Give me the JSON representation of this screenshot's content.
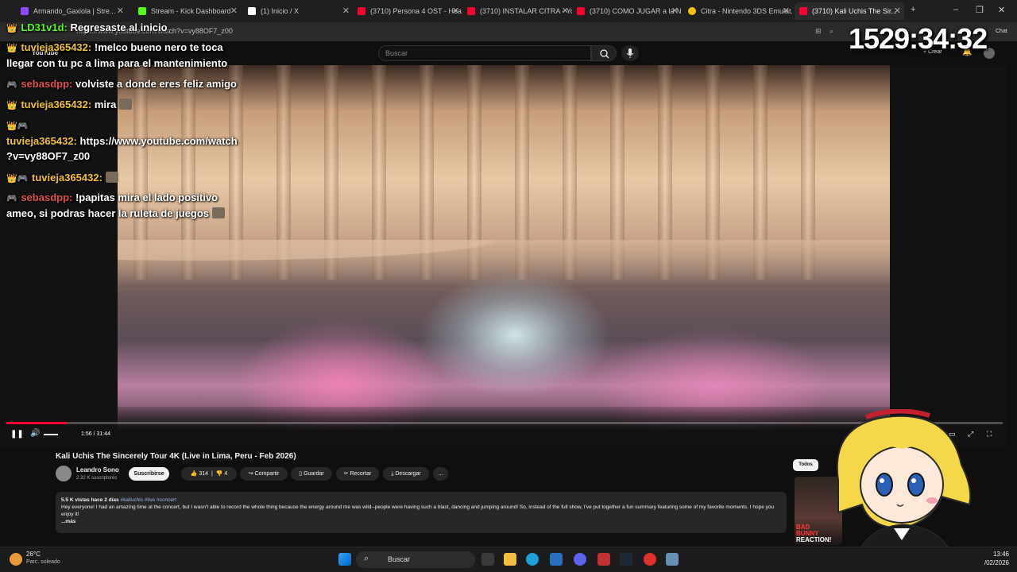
{
  "browser": {
    "tabs": [
      {
        "label": "Armando_Gaxiola | Stre...",
        "favicon_color": "#9146ff"
      },
      {
        "label": "Stream - Kick Dashboard",
        "favicon_color": "#53fc18"
      },
      {
        "label": "(1) Inicio / X",
        "favicon_color": "#ffffff"
      },
      {
        "label": "(3710) Persona 4 OST - Hea...",
        "favicon_color": "#ff0033"
      },
      {
        "label": "(3710) INSTALAR CITRA - Yo...",
        "favicon_color": "#ff0033"
      },
      {
        "label": "(3710) COMO JUGAR a la NI...",
        "favicon_color": "#ff0033"
      },
      {
        "label": "Citra - Nintendo 3DS Emulat...",
        "favicon_color": "#f5c400"
      },
      {
        "label": "(3710) Kali Uchis The Sir...",
        "favicon_color": "#ff0033"
      }
    ],
    "url": "https://www.youtube.com/watch?v=vy88OF7_z00",
    "chat_label": "Chat"
  },
  "youtube": {
    "logo_text": "YouTube",
    "search_placeholder": "Buscar",
    "create_label": "Crear"
  },
  "video": {
    "time_display": "1:56 / 31:44",
    "progress": 0.061,
    "title": "Kali Uchis The Sincerely Tour 4K (Live in Lima, Peru - Feb 2026)",
    "channel_name": "Leandro Sono",
    "subscribers": "2.32 K suscriptores",
    "subscribe_label": "Suscribirse",
    "likes": "314",
    "dislikes": "4",
    "share_label": "Compartir",
    "save_label": "Guardar",
    "clip_label": "Recortar",
    "download_label": "Descargar",
    "more_label": "...",
    "desc_meta": "5.5 K vistas  hace 2 días",
    "desc_tags": "#kaliuchis #live #concert",
    "desc_text": "Hey everyone! I had an amazing time at the concert, but I wasn't able to record the whole thing because the energy around me was wild--people were having such a blast, dancing and jumping around! So, instead of the full show, I've put together a fun summary featuring some of my favorite moments. I hope you enjoy it!",
    "desc_more": "...más"
  },
  "sidebar": {
    "filter_label": "Todos",
    "rec_label_1": "BAD",
    "rec_label_2": "BUNNY",
    "rec_label_3": "REACTION!"
  },
  "overlay_chat": [
    {
      "user": "LD31v1d:",
      "text": "Regresaste al inicio",
      "color": "#53fc18"
    },
    {
      "user": "tuvieja365432:",
      "text": "!melco bueno nero te toca",
      "color": "#f2c230"
    },
    {
      "user": "",
      "text": "llegar con tu pc a lima para el mantenimiento",
      "color": "#f2c230"
    },
    {
      "user": "sebasdpp:",
      "text": "volviste a donde eres feliz amigo",
      "color": "#e05050"
    },
    {
      "user": "tuvieja365432:",
      "text": "mira",
      "color": "#f2c230"
    },
    {
      "user": "tuvieja365432:",
      "text": "https://www.youtube.com/watch",
      "color": "#f2c230"
    },
    {
      "user": "",
      "text": "?v=vy88OF7_z00",
      "color": "#f2c230"
    },
    {
      "user": "tuvieja365432:",
      "text": "",
      "color": "#f2c230"
    },
    {
      "user": "sebasdpp:",
      "text": "!papitas mira el lado positivo",
      "color": "#e05050"
    },
    {
      "user": "",
      "text": "ameo, si podras hacer la ruleta de juegos",
      "color": "#e05050"
    }
  ],
  "stream_timer": "1529:34:32",
  "taskbar": {
    "weather_temp": "26°C",
    "weather_desc": "Parc. soleado",
    "search_label": "Buscar",
    "time": "13:46",
    "date": "/02/2026"
  },
  "colors": {
    "accent_red": "#ff0033",
    "bg": "#0f0f0f",
    "chip": "#272727"
  }
}
